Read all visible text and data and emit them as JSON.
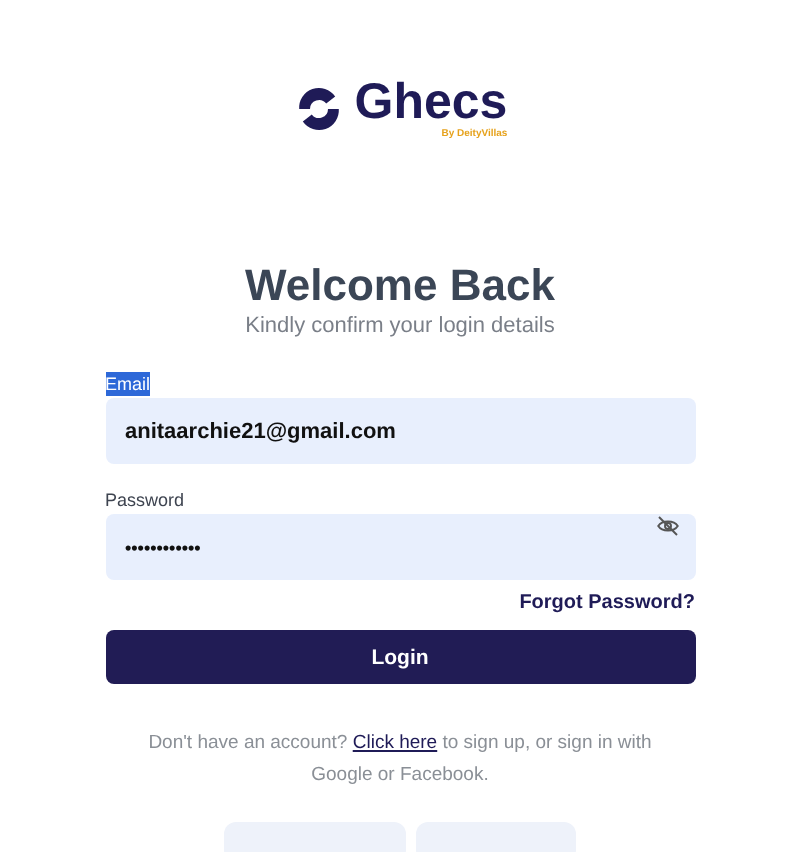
{
  "logo": {
    "name": "Ghecs",
    "tagline": "By DeityVillas"
  },
  "heading": {
    "title": "Welcome Back",
    "subtitle": "Kindly confirm your login details"
  },
  "email": {
    "label": "Email",
    "label_highlighted": true,
    "value": "anitaarchie21@gmail.com"
  },
  "password": {
    "label": "Password",
    "value": "••••••••••••"
  },
  "forgot_link": "Forgot Password?",
  "login_button": "Login",
  "signup": {
    "before": "Don't have an account? ",
    "link": "Click here",
    "after": " to sign up, or sign in with Google or Facebook."
  }
}
